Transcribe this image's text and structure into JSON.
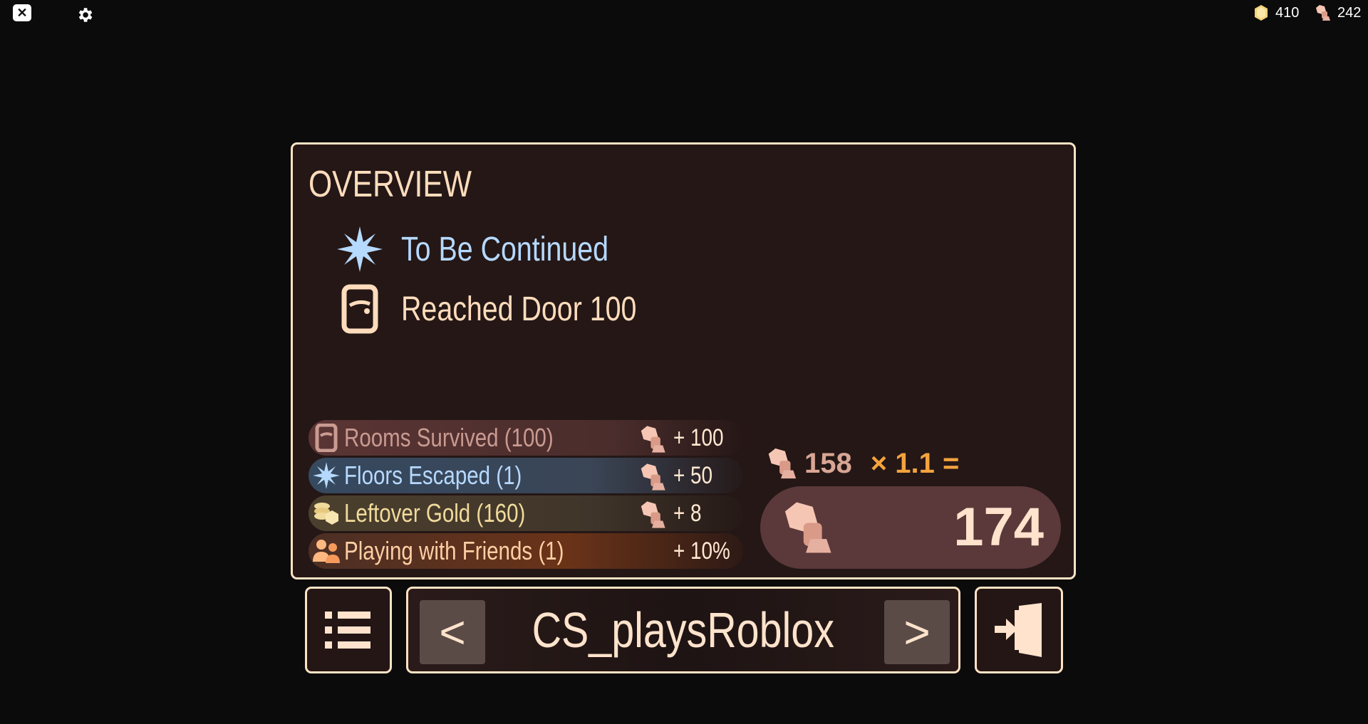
{
  "topbar": {
    "close_label": "✕",
    "gold_amount": "410",
    "knobs_amount": "242"
  },
  "overview": {
    "title": "OVERVIEW",
    "achievements": [
      {
        "label": "To Be Continued",
        "icon": "star-burst-icon",
        "color": "#b6d9ff"
      },
      {
        "label": "Reached Door 100",
        "icon": "door-icon",
        "color": "#ffdcbc"
      }
    ],
    "rewards": [
      {
        "label": "Rooms Survived (100)",
        "value": "+ 100",
        "icon": "door-icon"
      },
      {
        "label": "Floors Escaped (1)",
        "value": "+ 50",
        "icon": "star-burst-icon"
      },
      {
        "label": "Leftover Gold (160)",
        "value": "+ 8",
        "icon": "coins-icon"
      },
      {
        "label": "Playing with Friends (1)",
        "value": "+ 10%",
        "icon": "friends-icon"
      }
    ],
    "subtotal": "158",
    "multiplier": "× 1.1 =",
    "total": "174"
  },
  "bottom": {
    "prev_label": "<",
    "next_label": ">",
    "player_name": "CS_playsRoblox"
  },
  "colors": {
    "frame": "#ffe3c4",
    "panel_bg": "#241716",
    "accent_orange": "#f4a33e",
    "floor_blue": "#b6d9ff"
  }
}
